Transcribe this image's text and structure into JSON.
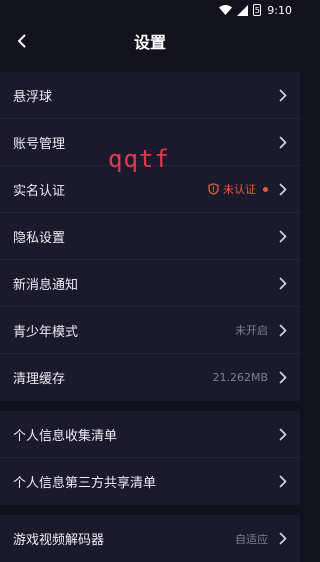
{
  "status_bar": {
    "time": "9:10",
    "battery_level": "5"
  },
  "header": {
    "title": "设置"
  },
  "groups": [
    {
      "rows": [
        {
          "label": "悬浮球"
        },
        {
          "label": "账号管理"
        },
        {
          "label": "实名认证",
          "warning": "未认证"
        },
        {
          "label": "隐私设置"
        },
        {
          "label": "新消息通知"
        },
        {
          "label": "青少年模式",
          "value": "未开启"
        },
        {
          "label": "清理缓存",
          "value": "21.262MB"
        }
      ]
    },
    {
      "rows": [
        {
          "label": "个人信息收集清单"
        },
        {
          "label": "个人信息第三方共享清单"
        }
      ]
    },
    {
      "rows": [
        {
          "label": "游戏视频解码器",
          "value": "自适应"
        }
      ]
    }
  ],
  "overlay": {
    "watermark": "qqtf"
  },
  "colors": {
    "background": "#12121f",
    "card": "#1b1a2c",
    "warning": "#e85b3a",
    "watermark": "#e23a4d"
  },
  "icons": {
    "back": "chevron-left-icon",
    "row": "chevron-right-icon",
    "warning": "shield-alert-icon"
  }
}
